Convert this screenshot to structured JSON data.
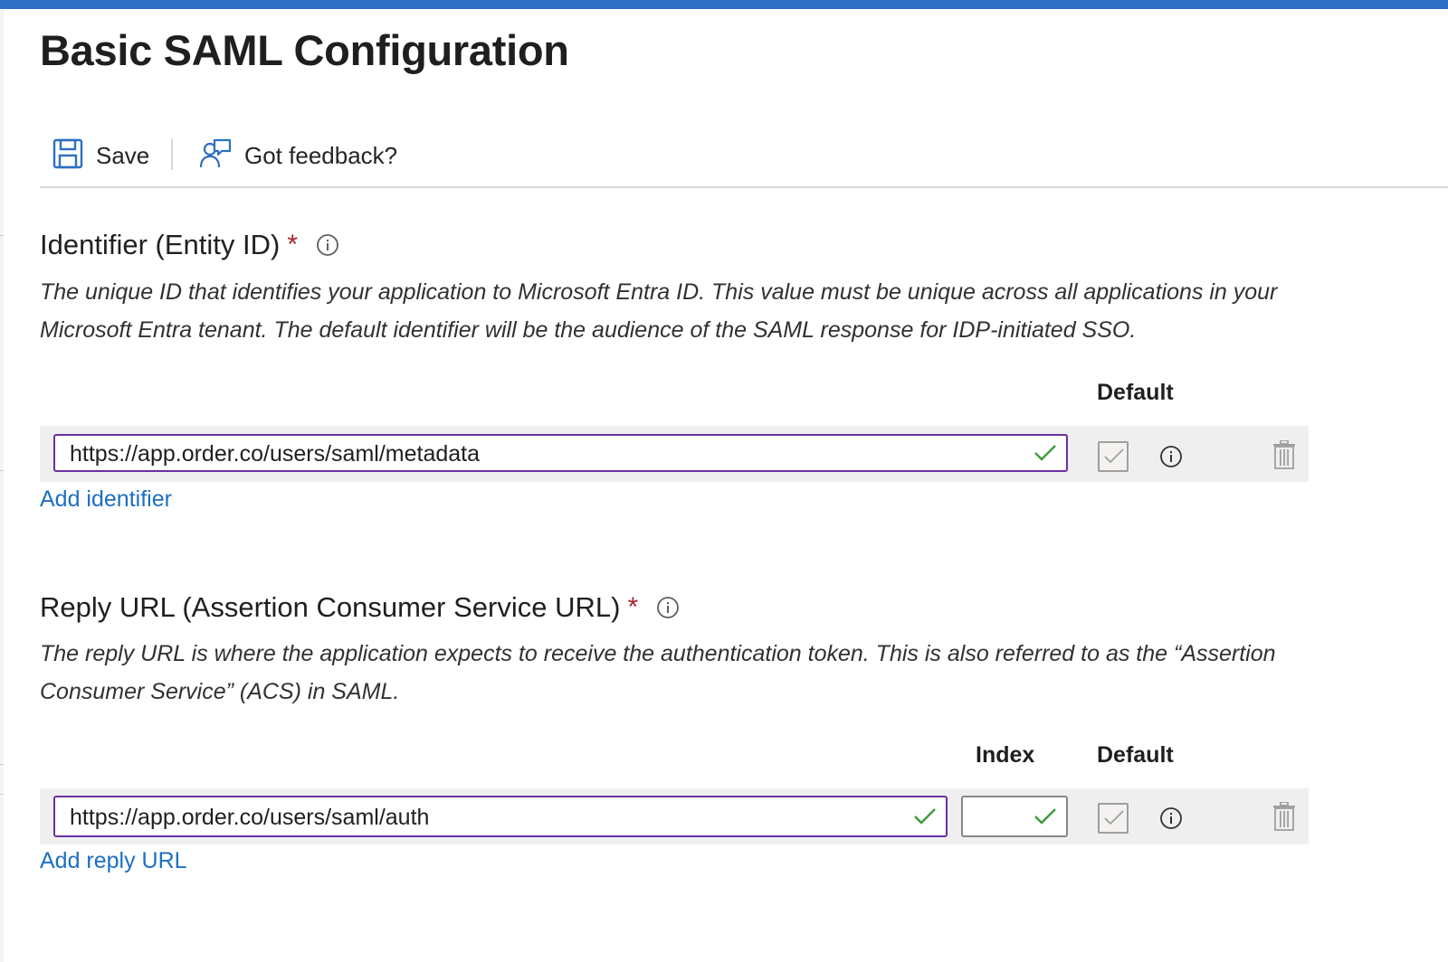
{
  "page": {
    "title": "Basic SAML Configuration",
    "accent_color": "#2d6fc4"
  },
  "toolbar": {
    "save_label": "Save",
    "save_icon": "save-icon",
    "feedback_label": "Got feedback?",
    "feedback_icon": "feedback-icon"
  },
  "identifier": {
    "heading": "Identifier (Entity ID)",
    "required_mark": "*",
    "description": "The unique ID that identifies your application to Microsoft Entra ID. This value must be unique across all applications in your Microsoft Entra tenant. The default identifier will be the audience of the SAML response for IDP-initiated SSO.",
    "col_default": "Default",
    "rows": [
      {
        "value": "https://app.order.co/users/saml/metadata",
        "is_default": true
      }
    ],
    "add_link": "Add identifier"
  },
  "reply_url": {
    "heading": "Reply URL (Assertion Consumer Service URL)",
    "required_mark": "*",
    "description": "The reply URL is where the application expects to receive the authentication token. This is also referred to as the “Assertion Consumer Service” (ACS) in SAML.",
    "col_index": "Index",
    "col_default": "Default",
    "rows": [
      {
        "value": "https://app.order.co/users/saml/auth",
        "index": "",
        "is_default": true
      }
    ],
    "add_link": "Add reply URL"
  },
  "colors": {
    "required": "#a4262c",
    "link": "#1c6fc4",
    "input_border_focus": "#6b2fa0",
    "valid_check": "#3c9b3c"
  }
}
